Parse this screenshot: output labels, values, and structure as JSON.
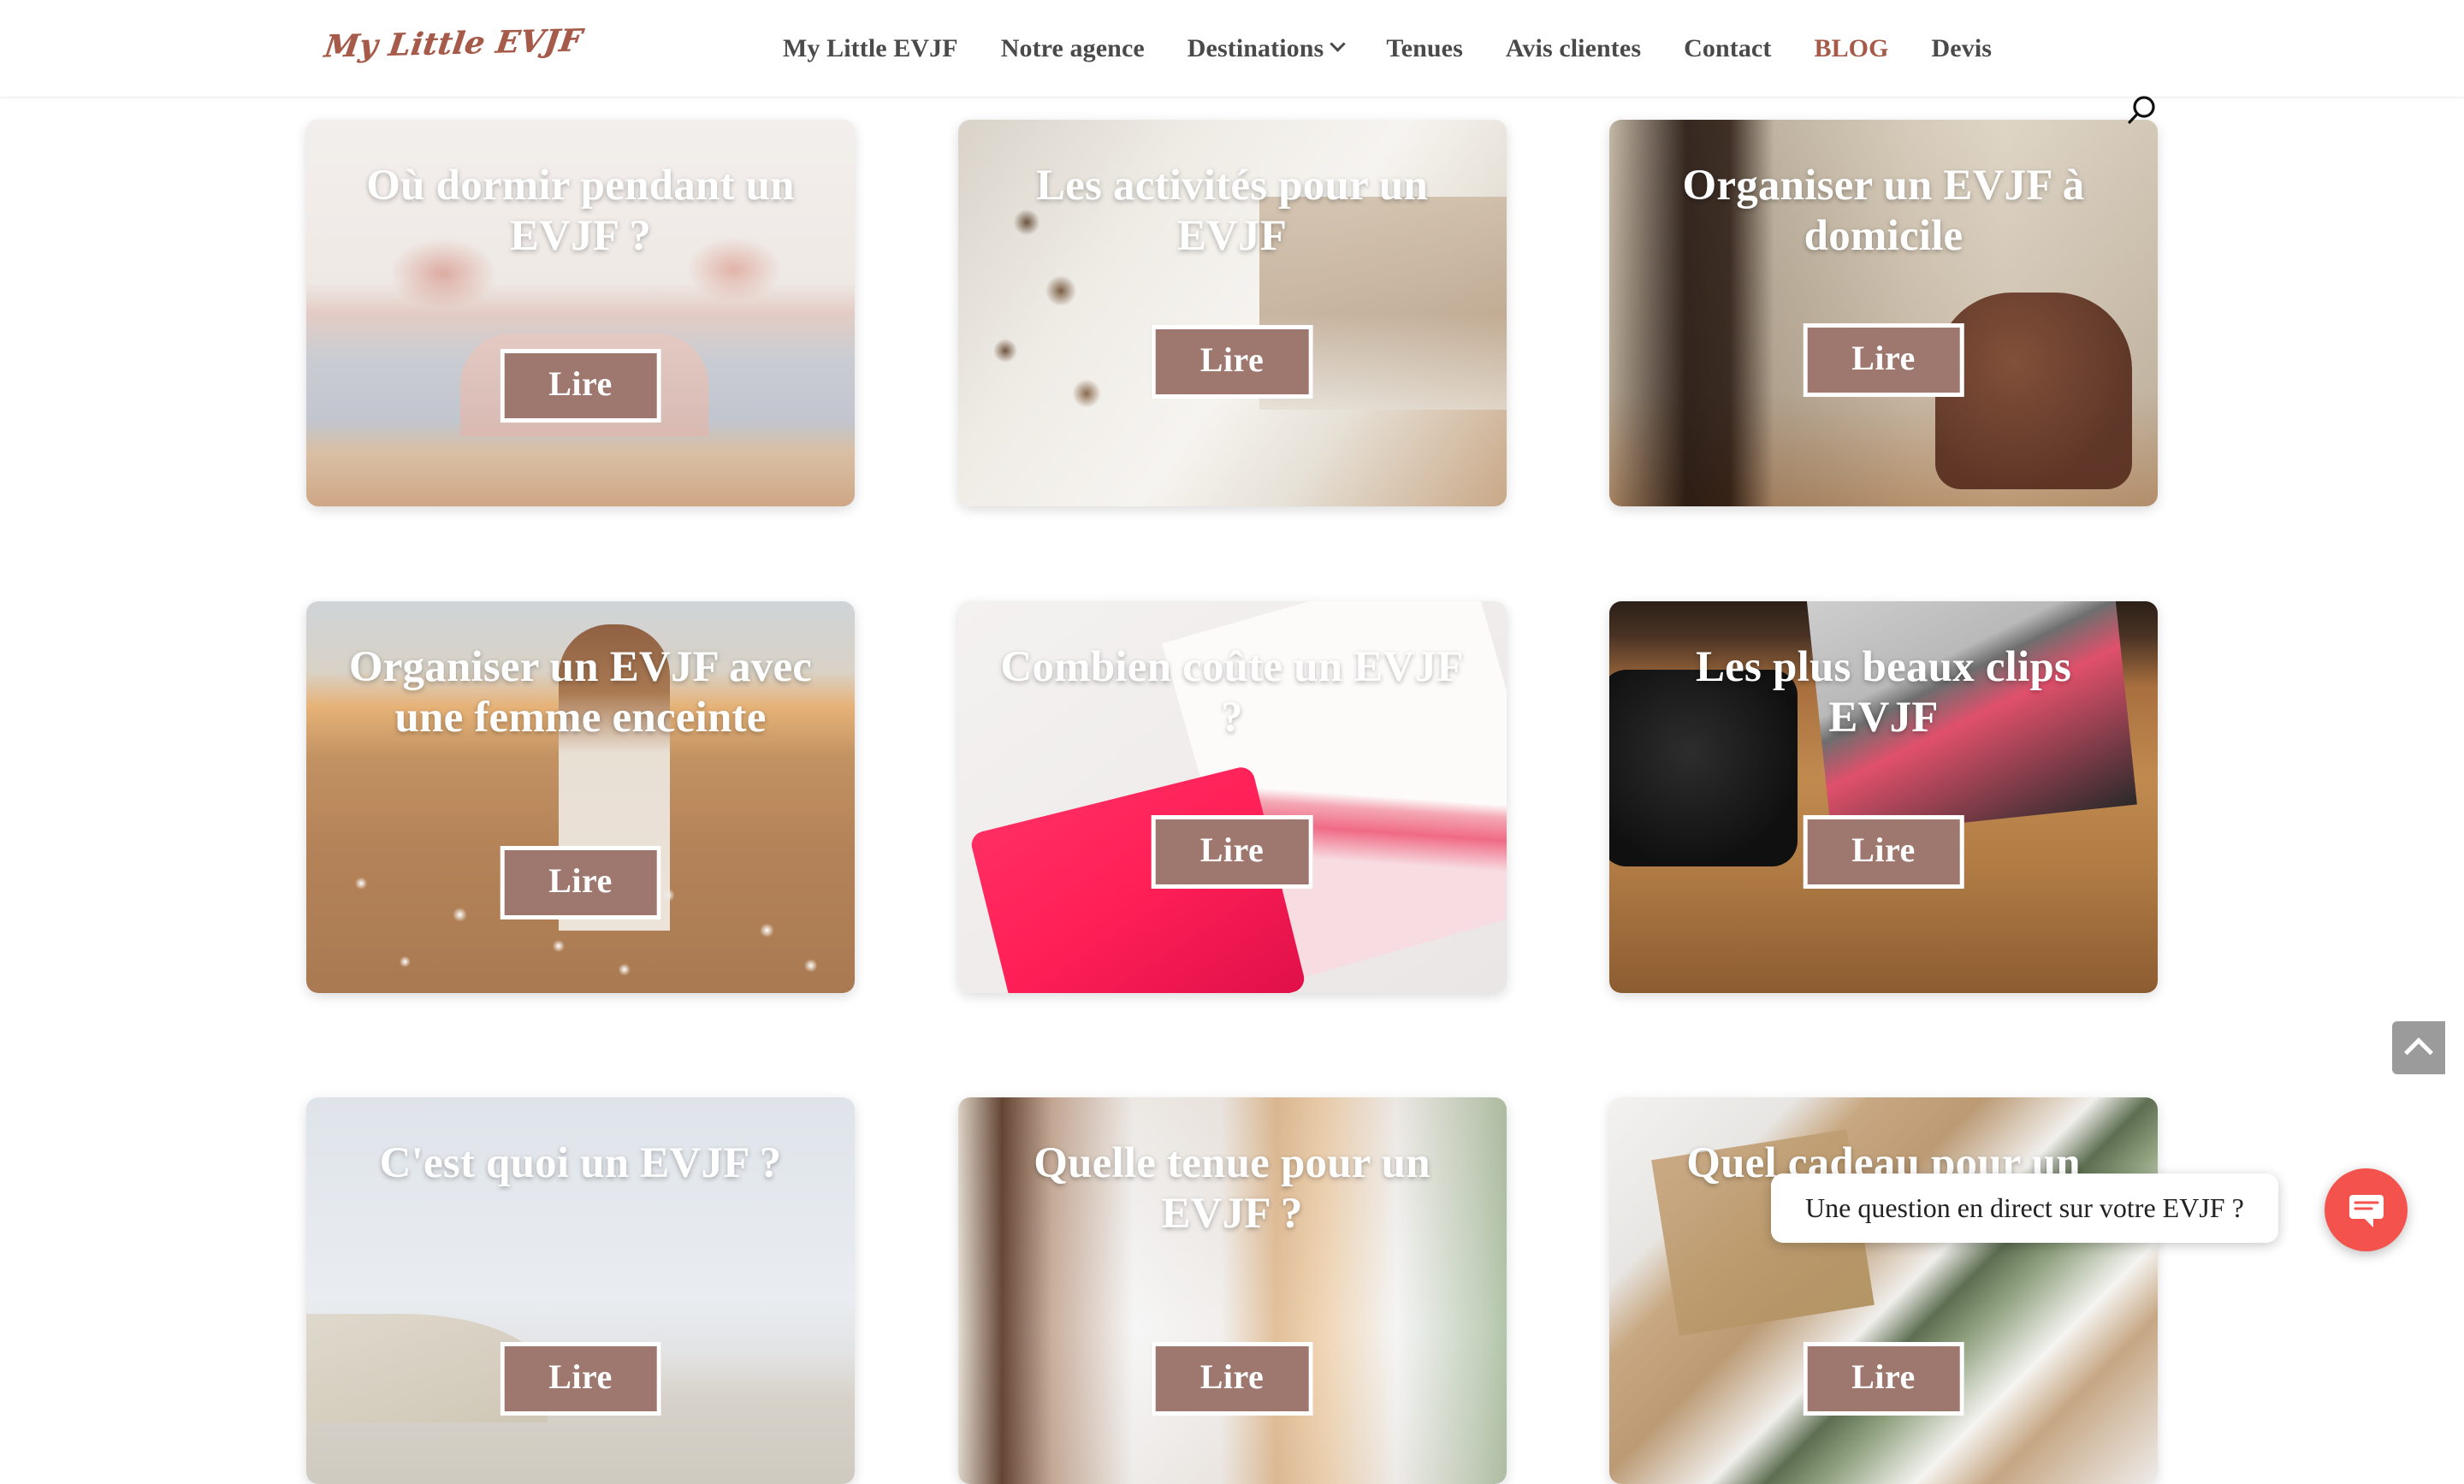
{
  "site": {
    "brand": "My Little EVJF",
    "accent_color": "#a65a4a",
    "button_color": "#9e776e",
    "chat_color": "#f4534d"
  },
  "header": {
    "logo_text": "My Little EVJF",
    "nav": [
      {
        "label": "My Little EVJF",
        "active": false,
        "has_dropdown": false
      },
      {
        "label": "Notre agence",
        "active": false,
        "has_dropdown": false
      },
      {
        "label": "Destinations",
        "active": false,
        "has_dropdown": true
      },
      {
        "label": "Tenues",
        "active": false,
        "has_dropdown": false
      },
      {
        "label": "Avis clientes",
        "active": false,
        "has_dropdown": false
      },
      {
        "label": "Contact",
        "active": false,
        "has_dropdown": false
      },
      {
        "label": "BLOG",
        "active": true,
        "has_dropdown": false
      },
      {
        "label": "Devis",
        "active": false,
        "has_dropdown": false
      }
    ],
    "search_icon": "search-icon"
  },
  "cards": [
    {
      "title": "Où dormir pendant un EVJF ?",
      "read_label": "Lire",
      "image": "bedroom-interior-photo"
    },
    {
      "title": "Les activités pour un EVJF",
      "read_label": "Lire",
      "image": "poolside-women-photo"
    },
    {
      "title": "Organiser un EVJF à domicile",
      "read_label": "Lire",
      "image": "living-room-interior-photo"
    },
    {
      "title": "Organiser un EVJF avec une femme enceinte",
      "read_label": "Lire",
      "image": "cotton-field-sunset-photo"
    },
    {
      "title": "Combien coûte un EVJF ?",
      "read_label": "Lire",
      "image": "pink-calculator-notebook-photo"
    },
    {
      "title": "Les plus beaux clips EVJF",
      "read_label": "Lire",
      "image": "camera-laptop-desk-photo"
    },
    {
      "title": "C'est quoi un EVJF ?",
      "read_label": "Lire",
      "image": "beach-women-white-dresses-photo"
    },
    {
      "title": "Quelle tenue pour un EVJF ?",
      "read_label": "Lire",
      "image": "women-white-tshirts-photo"
    },
    {
      "title": "Quel cadeau pour un EVJF ?",
      "read_label": "Lire",
      "image": "wrapped-gifts-photo"
    }
  ],
  "chat": {
    "message": "Une question en direct sur votre EVJF ?",
    "launcher_icon": "chat-bubble-icon"
  },
  "scroll_top": {
    "icon": "chevron-up-icon"
  }
}
